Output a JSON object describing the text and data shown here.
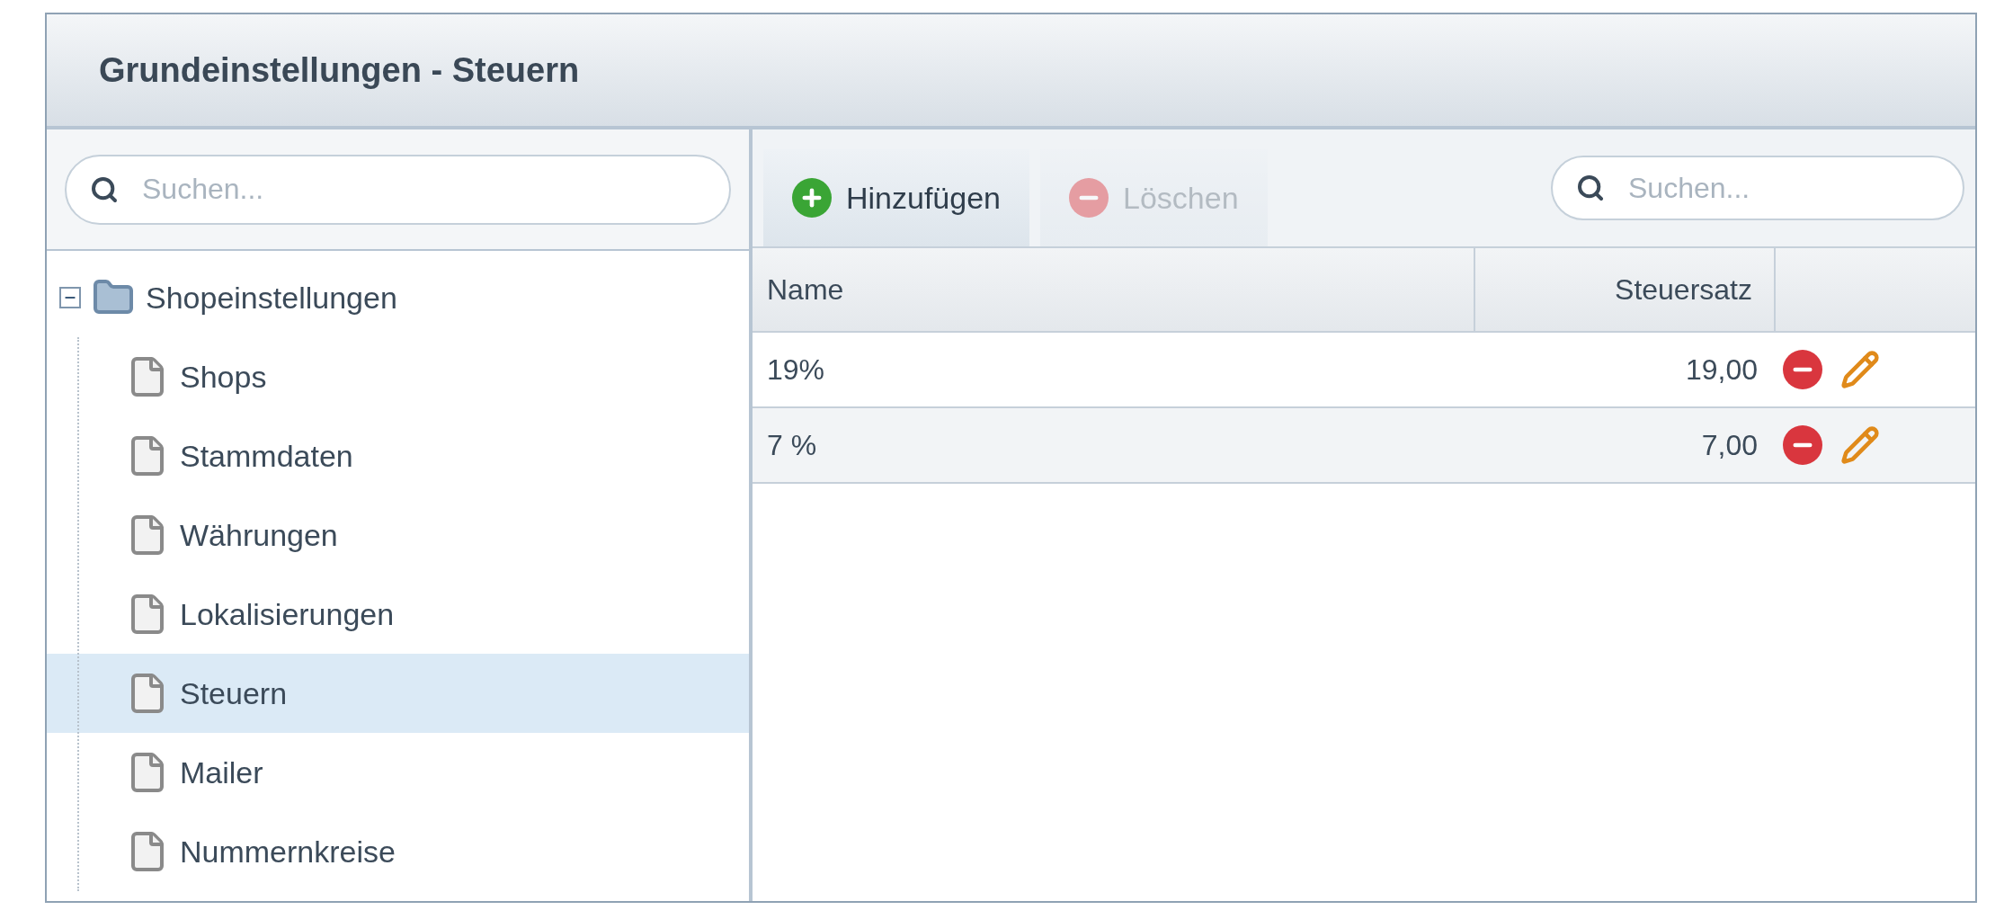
{
  "window": {
    "title": "Grundeinstellungen - Steuern"
  },
  "sidebar": {
    "search": {
      "placeholder": "Suchen..."
    },
    "tree": [
      {
        "label": "Shopeinstellungen",
        "expanded": true,
        "selected": false,
        "children": [
          {
            "label": "Shops",
            "selected": false
          },
          {
            "label": "Stammdaten",
            "selected": false
          },
          {
            "label": "Währungen",
            "selected": false
          },
          {
            "label": "Lokalisierungen",
            "selected": false
          },
          {
            "label": "Steuern",
            "selected": true
          },
          {
            "label": "Mailer",
            "selected": false
          },
          {
            "label": "Nummernkreise",
            "selected": false
          }
        ]
      }
    ]
  },
  "toolbar": {
    "buttons": [
      {
        "label": "Hinzufügen",
        "kind": "add",
        "disabled": false
      },
      {
        "label": "Löschen",
        "kind": "delete",
        "disabled": true
      }
    ],
    "search": {
      "placeholder": "Suchen..."
    }
  },
  "table": {
    "columns": [
      "Name",
      "Steuersatz"
    ],
    "rows": [
      {
        "name": "19%",
        "rate": "19,00"
      },
      {
        "name": "7 %",
        "rate": "7,00"
      }
    ]
  }
}
